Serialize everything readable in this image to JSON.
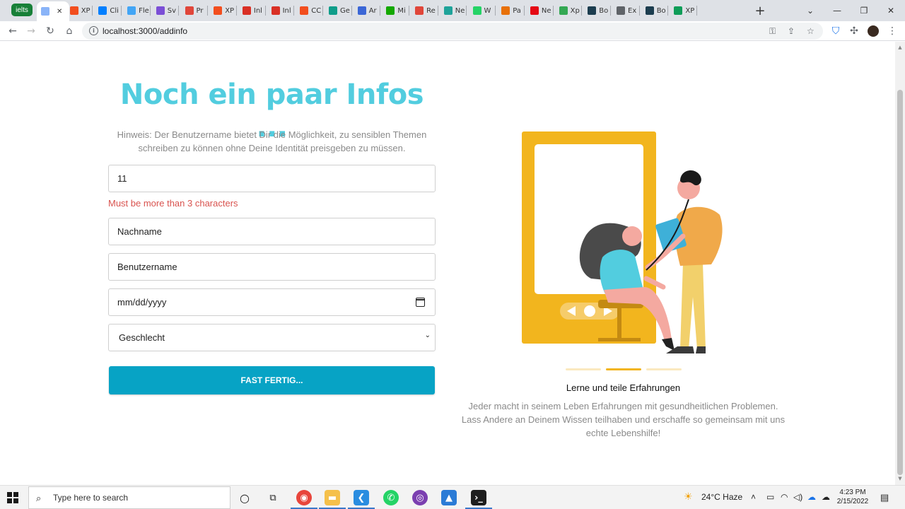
{
  "browser": {
    "group_label": "ielts",
    "tabs": [
      {
        "label": "",
        "icon": "page-icon",
        "color": "#8ab4f8"
      },
      {
        "label": "XP",
        "icon": "figma-icon",
        "color": "#f24e1e"
      },
      {
        "label": "Cli",
        "icon": "mui-icon",
        "color": "#007fff"
      },
      {
        "label": "Fle",
        "icon": "flutter-icon",
        "color": "#42a5f5"
      },
      {
        "label": "Sv",
        "icon": "s-icon",
        "color": "#7b4fd6"
      },
      {
        "label": "Pr",
        "icon": "doc-icon",
        "color": "#e0463a"
      },
      {
        "label": "XP",
        "icon": "figma-icon",
        "color": "#f24e1e"
      },
      {
        "label": "Inl",
        "icon": "gmail-icon",
        "color": "#d93025"
      },
      {
        "label": "Inl",
        "icon": "gmail-icon",
        "color": "#d93025"
      },
      {
        "label": "CC",
        "icon": "figma-icon",
        "color": "#f24e1e"
      },
      {
        "label": "Ge",
        "icon": "diamond-icon",
        "color": "#0f9d8a"
      },
      {
        "label": "Ar",
        "icon": "rpi-icon",
        "color": "#3b66d6"
      },
      {
        "label": "Mi",
        "icon": "upwork-icon",
        "color": "#14a800"
      },
      {
        "label": "Re",
        "icon": "github-icon",
        "color": "#e0463a"
      },
      {
        "label": "Ne",
        "icon": "node-icon",
        "color": "#1fa39a"
      },
      {
        "label": "W",
        "icon": "whatsapp-icon",
        "color": "#25d366"
      },
      {
        "label": "Pa",
        "icon": "triangle-icon",
        "color": "#e8710a"
      },
      {
        "label": "Ne",
        "icon": "netflix-icon",
        "color": "#e50914"
      },
      {
        "label": "Xp",
        "icon": "leaf-icon",
        "color": "#34a853"
      },
      {
        "label": "Bo",
        "icon": "bootstrap-icon",
        "color": "#1c3d4f"
      },
      {
        "label": "Ex",
        "icon": "puzzle-icon",
        "color": "#5f6368"
      },
      {
        "label": "Bo",
        "icon": "bootstrap-icon",
        "color": "#1c3d4f"
      },
      {
        "label": "XP",
        "icon": "sheets-icon",
        "color": "#0f9d58"
      }
    ],
    "url": "localhost:3000/addinfo"
  },
  "form": {
    "title": "Noch ein paar Infos ...",
    "hint": "Hinweis: Der Benutzername bietet Dir die Möglichkeit, zu sensiblen Themen schreiben zu können ohne Deine Identität preisgeben zu müssen.",
    "first_name_value": "11",
    "error_message": "Must be more than 3 characters",
    "last_name_placeholder": "Nachname",
    "username_placeholder": "Benutzername",
    "date_placeholder": "mm/dd/yyyy",
    "gender_selected": "Geschlecht",
    "submit_label": "FAST FERTIG..."
  },
  "slide": {
    "title": "Lerne und teile Erfahrungen",
    "text": "Jeder macht in seinem Leben Erfahrungen mit gesundheitlichen Problemen. Lass Andere an Deinem Wissen teilhaben und erschaffe so gemeinsam mit uns echte Lebenshilfe!",
    "active_index": 1,
    "count": 3
  },
  "taskbar": {
    "search_placeholder": "Type here to search",
    "weather": "24°C  Haze",
    "time": "4:23 PM",
    "date": "2/15/2022"
  },
  "colors": {
    "title": "#52cddf",
    "button": "#07a3c5",
    "error": "#d9534f",
    "illustration": "#f2b51e"
  }
}
